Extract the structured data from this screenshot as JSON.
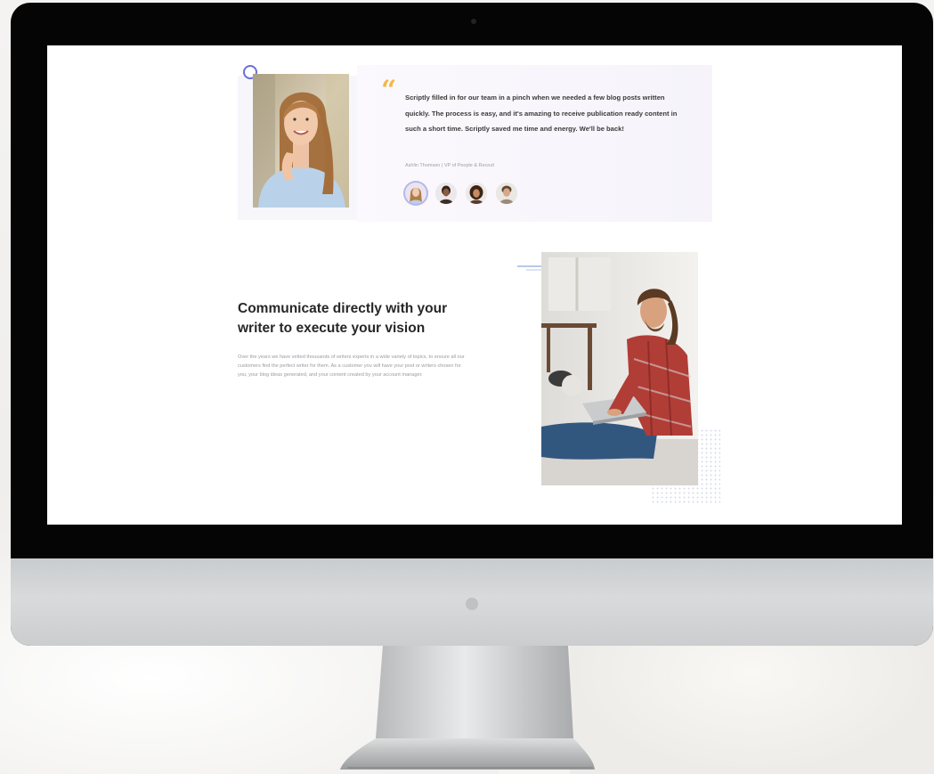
{
  "testimonial": {
    "quote": "Scriptly filled in for our team in a pinch when we needed a few blog posts written quickly. The process is easy, and it's amazing to receive publication ready content in such a short time. Scriptly saved me time and energy. We'll be back!",
    "author": "Ashlin Thomsen  |  VP of People & Recruit",
    "quote_mark": "“"
  },
  "feature": {
    "title": "Communicate directly with your writer to execute your vision",
    "body": "Over the years we have vetted thousands of writers experts in a wide variety of topics, to ensure all our customers find the perfect writer for them. As a customer you will have your post or writers chosen for you, your blog ideas generated, and your content created by your account manager."
  },
  "colors": {
    "accent": "#6a6fd9",
    "quote_mark": "#f2b84b",
    "card_bg": "#f7f4fb"
  }
}
